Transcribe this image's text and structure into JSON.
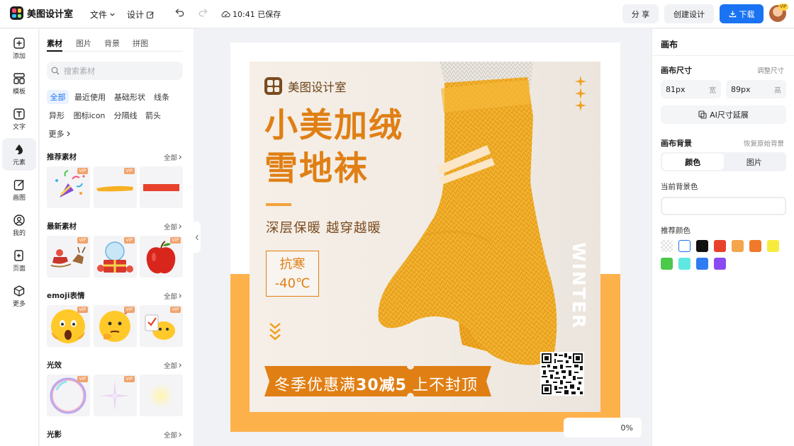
{
  "app": {
    "name": "美图设计室",
    "menu_file": "文件",
    "menu_design": "设计",
    "save_status": "10:41 已保存",
    "btn_share": "分 享",
    "btn_create": "创建设计",
    "btn_download": "下载",
    "avatar_badge": "VIP"
  },
  "rail": {
    "items": [
      {
        "label": "添加",
        "icon": "plus-square-icon"
      },
      {
        "label": "模板",
        "icon": "template-icon"
      },
      {
        "label": "文字",
        "icon": "text-icon"
      },
      {
        "label": "元素",
        "icon": "shapes-icon"
      },
      {
        "label": "画图",
        "icon": "edit-icon"
      },
      {
        "label": "我的",
        "icon": "user-icon"
      },
      {
        "label": "页面",
        "icon": "page-add-icon"
      },
      {
        "label": "更多",
        "icon": "cube-icon"
      }
    ],
    "active": "元素"
  },
  "panel": {
    "tabs": [
      "素材",
      "图片",
      "背景",
      "拼图"
    ],
    "search_placeholder": "搜索素材",
    "chips": [
      "全部",
      "最近使用",
      "基础形状",
      "线条",
      "异形",
      "图标icon",
      "分隔线",
      "箭头",
      "更多"
    ],
    "sections": [
      {
        "title": "推荐素材",
        "all": "全部"
      },
      {
        "title": "最新素材",
        "all": "全部"
      },
      {
        "title": "emoji表情",
        "all": "全部"
      },
      {
        "title": "光效",
        "all": "全部"
      },
      {
        "title": "光影",
        "all": "全部"
      }
    ],
    "vip_badge": "VIP"
  },
  "poster": {
    "brand": "美图设计室",
    "headline_1": "小美加绒",
    "headline_2": "雪地袜",
    "subline": "深层保暖 越穿越暖",
    "cold_1": "抗寒",
    "cold_2": "-40℃",
    "winter": "WINTER",
    "promo_a": "冬季优惠满",
    "promo_b": "30减5",
    "promo_c": " 上不封顶",
    "colors": {
      "orange": "#e07f14",
      "band": "#fdb14b",
      "brown": "#7a4b1f",
      "sock": "#f0a821"
    }
  },
  "zoom": {
    "value": "0%"
  },
  "inspector": {
    "title": "画布",
    "size_label": "画布尺寸",
    "size_link": "调整尺寸",
    "width": "81px",
    "width_unit": "宽",
    "height": "89px",
    "height_unit": "高",
    "ai_button": "AI尺寸延展",
    "bg_label": "画布背景",
    "bg_link": "恢复原始背景",
    "seg_color": "颜色",
    "seg_image": "图片",
    "current_bg": "当前背景色",
    "recommended": "推荐颜色",
    "swatches": [
      "transparent",
      "#ffffff",
      "#111111",
      "#e8412c",
      "#f5a64d",
      "#f07a2a",
      "#f7ec3e",
      "#4cc84a",
      "#5fe8e2",
      "#2f7cf0",
      "#8a4cf0"
    ]
  }
}
